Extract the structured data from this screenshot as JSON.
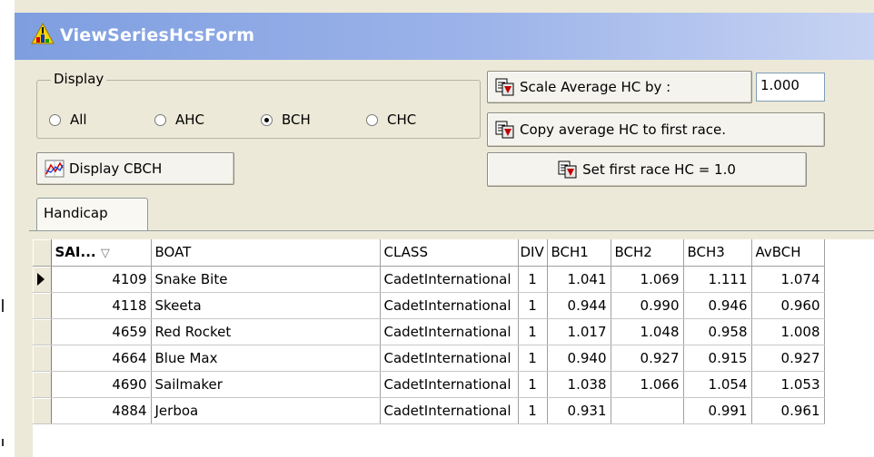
{
  "window": {
    "title": "ViewSeriesHcsForm"
  },
  "display_group": {
    "legend": "Display",
    "options": [
      {
        "label": "All",
        "checked": false
      },
      {
        "label": "AHC",
        "checked": false
      },
      {
        "label": "BCH",
        "checked": true
      },
      {
        "label": "CHC",
        "checked": false
      }
    ]
  },
  "buttons": {
    "display_cbch": "Display CBCH",
    "scale_average": "Scale Average  HC by :",
    "copy_average": "Copy average  HC to first race.",
    "set_first_race": "Set first race HC = 1.0"
  },
  "scale_value": "1.000",
  "tabs": [
    "Handicap"
  ],
  "grid": {
    "columns": [
      "SAI...",
      "BOAT",
      "CLASS",
      "DIV",
      "BCH1",
      "BCH2",
      "BCH3",
      "AvBCH"
    ],
    "sort_glyph": "▽",
    "rows": [
      {
        "sail": "4109",
        "boat": "Snake Bite",
        "class": "CadetInternational",
        "div": "1",
        "bch1": "1.041",
        "bch2": "1.069",
        "bch3": "1.111",
        "avbch": "1.074",
        "current": true
      },
      {
        "sail": "4118",
        "boat": "Skeeta",
        "class": "CadetInternational",
        "div": "1",
        "bch1": "0.944",
        "bch2": "0.990",
        "bch3": "0.946",
        "avbch": "0.960",
        "current": false
      },
      {
        "sail": "4659",
        "boat": "Red Rocket",
        "class": "CadetInternational",
        "div": "1",
        "bch1": "1.017",
        "bch2": "1.048",
        "bch3": "0.958",
        "avbch": "1.008",
        "current": false
      },
      {
        "sail": "4664",
        "boat": "Blue Max",
        "class": "CadetInternational",
        "div": "1",
        "bch1": "0.940",
        "bch2": "0.927",
        "bch3": "0.915",
        "avbch": "0.927",
        "current": false
      },
      {
        "sail": "4690",
        "boat": "Sailmaker",
        "class": "CadetInternational",
        "div": "1",
        "bch1": "1.038",
        "bch2": "1.066",
        "bch3": "1.054",
        "avbch": "1.053",
        "current": false
      },
      {
        "sail": "4884",
        "boat": "Jerboa",
        "class": "CadetInternational",
        "div": "1",
        "bch1": "0.931",
        "bch2": "",
        "bch3": "0.991",
        "avbch": "0.961",
        "current": false
      }
    ]
  },
  "colors": {
    "titlebar_start": "#7e9ee0",
    "titlebar_end": "#c7d3f2",
    "dialog_face": "#ece9d8",
    "grid_background": "#ffffff"
  },
  "icons": [
    "app-warning-icon",
    "chart-icon",
    "copy-document-icon"
  ]
}
